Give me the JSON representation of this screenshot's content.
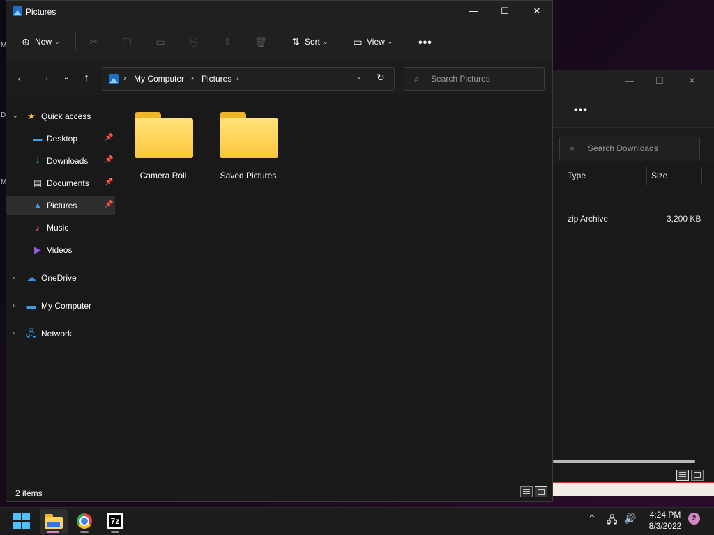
{
  "window": {
    "title": "Pictures",
    "controls": {
      "minimize": "—",
      "maximize": "☐",
      "close": "✕"
    }
  },
  "toolbar": {
    "new_label": "New",
    "sort_label": "Sort",
    "view_label": "View",
    "more_label": "•••",
    "icons": [
      "cut-icon",
      "copy-icon",
      "paste-icon",
      "rename-icon",
      "share-icon",
      "delete-icon"
    ]
  },
  "address": {
    "crumbs": [
      "My Computer",
      "Pictures"
    ],
    "separator": "›"
  },
  "search": {
    "placeholder": "Search Pictures"
  },
  "nav": {
    "items": [
      {
        "label": "Quick access",
        "icon": "star-icon",
        "color": "#f8c12c"
      },
      {
        "label": "Desktop",
        "icon": "desktop-icon",
        "color": "#3ea0e6",
        "pinned": true
      },
      {
        "label": "Downloads",
        "icon": "download-icon",
        "color": "#27b872",
        "pinned": true
      },
      {
        "label": "Documents",
        "icon": "documents-icon",
        "color": "#d0d0d0",
        "pinned": true
      },
      {
        "label": "Pictures",
        "icon": "pictures-icon",
        "color": "#3ea0e6",
        "pinned": true,
        "selected": true
      },
      {
        "label": "Music",
        "icon": "music-icon",
        "color": "#e95a6a"
      },
      {
        "label": "Videos",
        "icon": "videos-icon",
        "color": "#9a5bdc"
      },
      {
        "label": "OneDrive",
        "icon": "onedrive-icon",
        "color": "#2e8fe6"
      },
      {
        "label": "My Computer",
        "icon": "computer-icon",
        "color": "#3ea0e6"
      },
      {
        "label": "Network",
        "icon": "network-icon",
        "color": "#3ea0e6"
      }
    ],
    "pin_glyph": "📌"
  },
  "content": {
    "folders": [
      {
        "label": "Camera Roll"
      },
      {
        "label": "Saved Pictures"
      }
    ]
  },
  "status": {
    "count": "2 items"
  },
  "bg_window": {
    "more_label": "•••",
    "search_placeholder": "Search Downloads",
    "columns": [
      "Type",
      "Size"
    ],
    "row": {
      "type": "zip Archive",
      "size": "3,200 KB"
    }
  },
  "taskbar": {
    "apps": [
      "start-icon",
      "file-explorer-icon",
      "chrome-icon",
      "7zip-icon"
    ],
    "sevenz_label": "7z",
    "time": "4:24 PM",
    "date": "8/3/2022",
    "notification_count": "2"
  },
  "desktop": {
    "left_letters": [
      "M",
      "D",
      "M"
    ]
  }
}
